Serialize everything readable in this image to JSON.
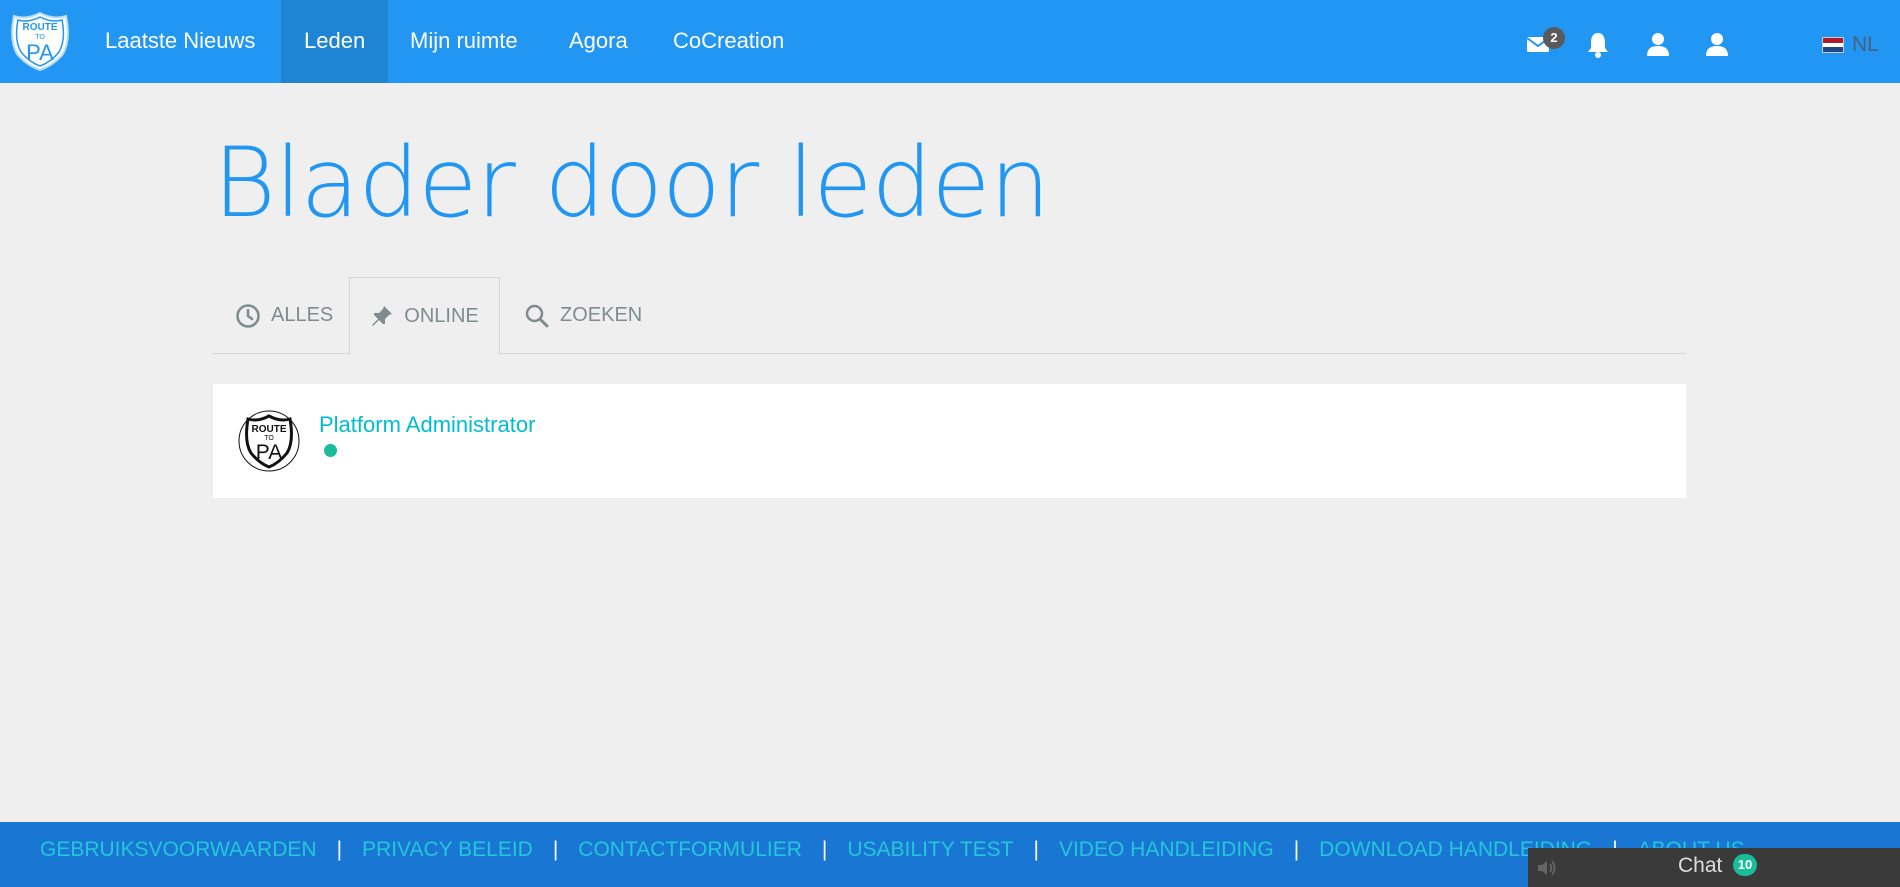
{
  "nav": {
    "logo_text": [
      "ROUTE",
      "TO",
      "PA"
    ],
    "items": [
      {
        "label": "Laatste Nieuws"
      },
      {
        "label": "Leden"
      },
      {
        "label": "Mijn ruimte"
      },
      {
        "label": "Agora"
      },
      {
        "label": "CoCreation"
      }
    ],
    "active_item": "Leden",
    "messages_count": "2",
    "language": "NL"
  },
  "page": {
    "title": "Blader door leden"
  },
  "tabs": [
    {
      "label": "ALLES",
      "icon": "clock-icon"
    },
    {
      "label": "ONLINE",
      "icon": "pin-icon"
    },
    {
      "label": "ZOEKEN",
      "icon": "search-icon"
    }
  ],
  "active_tab": "ONLINE",
  "members": [
    {
      "name": "Platform Administrator",
      "status": "online"
    }
  ],
  "footer": {
    "links": [
      "GEBRUIKSVOORWAARDEN",
      "PRIVACY BELEID",
      "CONTACTFORMULIER",
      "USABILITY TEST",
      "VIDEO HANDLEIDING",
      "DOWNLOAD HANDLEIDING",
      "ABOUT US"
    ]
  },
  "chat": {
    "label": "Chat",
    "count": "10"
  },
  "colors": {
    "brand": "#2196f3",
    "nav_active": "#1e84d4",
    "footer": "#1976d2",
    "link": "#00bcd4",
    "online": "#1abc9c"
  }
}
